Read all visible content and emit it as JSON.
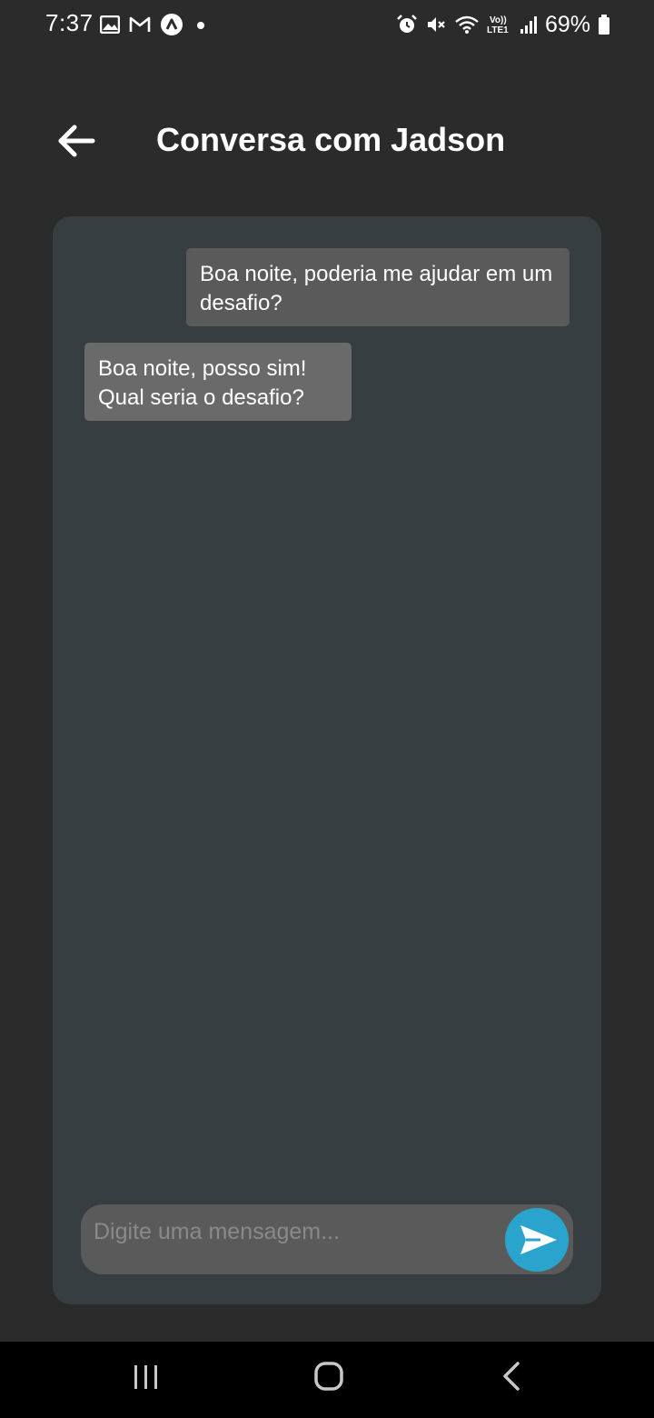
{
  "status_bar": {
    "time": "7:37",
    "battery": "69%",
    "left_icons": [
      "gallery-icon",
      "gmail-icon",
      "app-icon",
      "dot-icon"
    ],
    "right_icons": [
      "alarm-icon",
      "mute-icon",
      "wifi-icon",
      "volte-icon",
      "signal-icon",
      "battery-icon"
    ],
    "volte_label": "Vo)) LTE1"
  },
  "header": {
    "title": "Conversa com Jadson",
    "back_icon": "arrow-left-icon"
  },
  "chat": {
    "messages": [
      {
        "direction": "sent",
        "text": "Boa noite, poderia me ajudar em um desafio?"
      },
      {
        "direction": "received",
        "text": "Boa noite, posso sim! Qual seria o desafio?"
      }
    ]
  },
  "composer": {
    "placeholder": "Digite uma mensagem...",
    "value": "",
    "send_icon": "send-icon",
    "accent_color": "#2aa4cc"
  },
  "nav_bar": {
    "buttons": [
      "recents-icon",
      "home-icon",
      "back-icon"
    ]
  },
  "colors": {
    "background": "#2b2b2b",
    "panel": "#373e41",
    "bubble_sent": "#5a5a5a",
    "bubble_received": "#6a6a6a"
  }
}
